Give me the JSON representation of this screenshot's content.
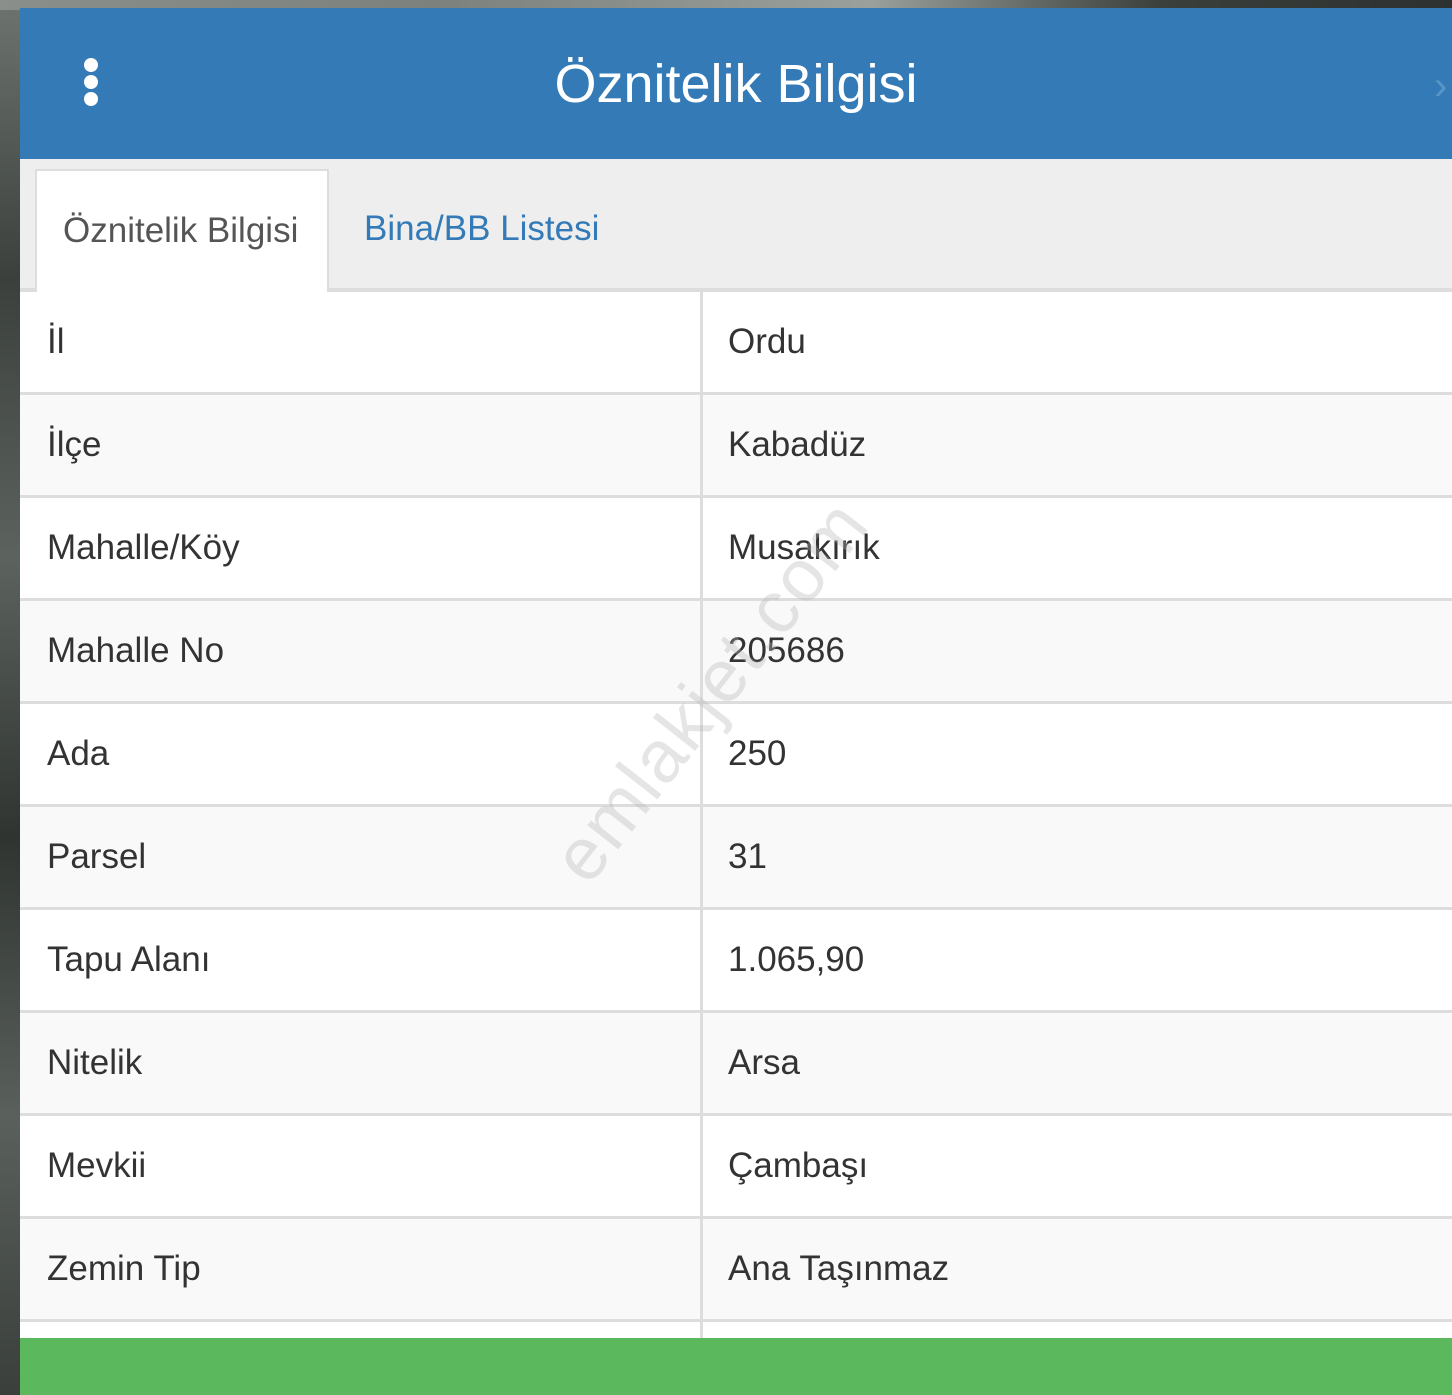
{
  "header": {
    "title": "Öznitelik Bilgisi"
  },
  "tabs": [
    {
      "label": "Öznitelik Bilgisi",
      "active": true
    },
    {
      "label": "Bina/BB Listesi",
      "active": false
    }
  ],
  "attributes": [
    {
      "label": "İl",
      "value": "Ordu"
    },
    {
      "label": "İlçe",
      "value": "Kabadüz"
    },
    {
      "label": "Mahalle/Köy",
      "value": "Musakırık"
    },
    {
      "label": "Mahalle No",
      "value": "205686"
    },
    {
      "label": "Ada",
      "value": "250"
    },
    {
      "label": "Parsel",
      "value": "31"
    },
    {
      "label": "Tapu Alanı",
      "value": "1.065,90"
    },
    {
      "label": "Nitelik",
      "value": "Arsa"
    },
    {
      "label": "Mevkii",
      "value": "Çambaşı"
    },
    {
      "label": "Zemin Tip",
      "value": "Ana Taşınmaz"
    }
  ],
  "watermark": "emlakjet.com",
  "colors": {
    "header": "#337ab7",
    "footer": "#5cb85c",
    "tab_link": "#337ab7"
  }
}
